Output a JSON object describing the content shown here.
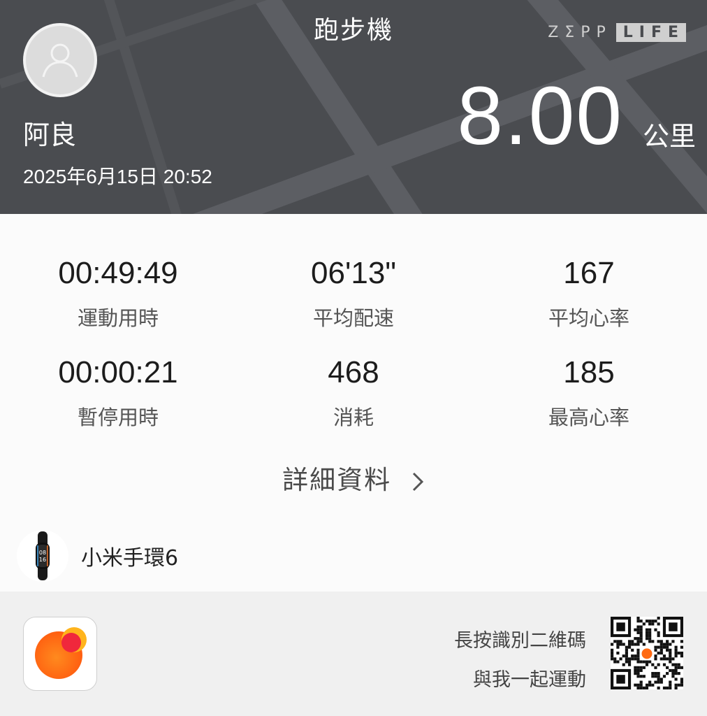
{
  "header": {
    "title": "跑步機",
    "brand_left": "ZΣPP",
    "brand_right": "LIFE",
    "username": "阿良",
    "datetime": "2025年6月15日 20:52",
    "distance": "8.00",
    "distance_unit": "公里"
  },
  "stats": [
    {
      "value": "00:49:49",
      "label": "運動用時"
    },
    {
      "value": "06'13\"",
      "label": "平均配速"
    },
    {
      "value": "167",
      "label": "平均心率"
    },
    {
      "value": "00:00:21",
      "label": "暫停用時"
    },
    {
      "value": "468",
      "label": "消耗"
    },
    {
      "value": "185",
      "label": "最高心率"
    }
  ],
  "details_label": "詳細資料",
  "device": {
    "name": "小米手環6",
    "screen_time_top": "08",
    "screen_time_bottom": "16"
  },
  "footer": {
    "scan_line1": "長按識別二維碼",
    "scan_line2": "與我一起運動"
  },
  "colors": {
    "header_bg": "#4a4c50",
    "accent_orange": "#ff6a13",
    "accent_red": "#f0283c"
  }
}
